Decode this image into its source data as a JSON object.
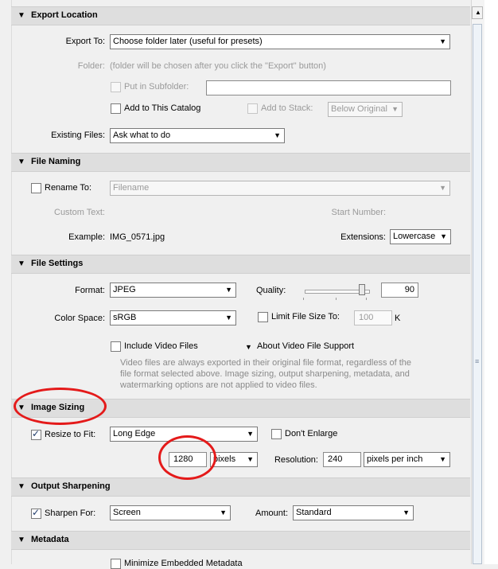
{
  "sections": {
    "export_location": "Export Location",
    "file_naming": "File Naming",
    "file_settings": "File Settings",
    "image_sizing": "Image Sizing",
    "output_sharpening": "Output Sharpening",
    "metadata": "Metadata"
  },
  "export_location": {
    "export_to_label": "Export To:",
    "export_to_value": "Choose folder later (useful for presets)",
    "folder_label": "Folder:",
    "folder_value": "(folder will be chosen after you click the \"Export\" button)",
    "put_in_subfolder": "Put in Subfolder:",
    "add_to_catalog": "Add to This Catalog",
    "add_to_stack": "Add to Stack:",
    "stack_value": "Below Original",
    "existing_files_label": "Existing Files:",
    "existing_files_value": "Ask what to do"
  },
  "file_naming": {
    "rename_to": "Rename To:",
    "rename_value": "Filename",
    "custom_text": "Custom Text:",
    "start_number": "Start Number:",
    "example_label": "Example:",
    "example_value": "IMG_0571.jpg",
    "extensions_label": "Extensions:",
    "extensions_value": "Lowercase"
  },
  "file_settings": {
    "format_label": "Format:",
    "format_value": "JPEG",
    "quality_label": "Quality:",
    "quality_value": "90",
    "color_space_label": "Color Space:",
    "color_space_value": "sRGB",
    "limit_file_size": "Limit File Size To:",
    "limit_value": "100",
    "limit_unit": "K",
    "include_video": "Include Video Files",
    "about_video": "About Video File Support",
    "video_note": "Video files are always exported in their original file format, regardless of the file format selected above. Image sizing, output sharpening, metadata, and watermarking options are not applied to video files."
  },
  "image_sizing": {
    "resize_to_fit": "Resize to Fit:",
    "resize_value": "Long Edge",
    "dont_enlarge": "Don't Enlarge",
    "size_value": "1280",
    "unit_value": "pixels",
    "resolution_label": "Resolution:",
    "resolution_value": "240",
    "resolution_unit": "pixels per inch"
  },
  "output_sharpening": {
    "sharpen_for": "Sharpen For:",
    "sharpen_value": "Screen",
    "amount_label": "Amount:",
    "amount_value": "Standard"
  },
  "metadata": {
    "minimize": "Minimize Embedded Metadata"
  },
  "icons": {
    "disclosure": "▼",
    "dropdown": "▼",
    "check": "✓"
  },
  "colors": {
    "annotation": "#e41a1a",
    "header_bg": "#dedede",
    "panel_bg": "#f0f0f0"
  },
  "quality_slider_fraction": 0.9
}
